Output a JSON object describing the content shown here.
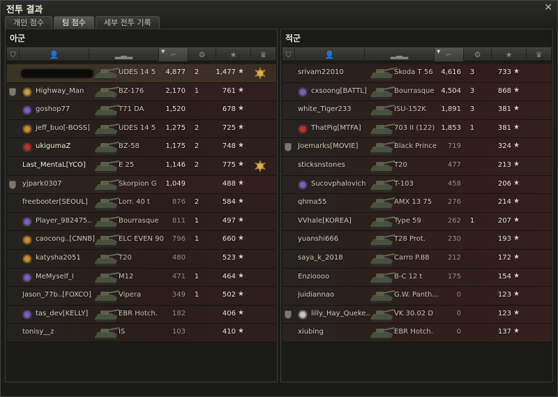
{
  "window": {
    "title": "전투 결과",
    "close_icon": "close-icon"
  },
  "tabs": [
    {
      "label": "개인 점수",
      "active": false
    },
    {
      "label": "팀 점수",
      "active": true
    },
    {
      "label": "세부 전투 기록",
      "active": false
    }
  ],
  "header_icons": [
    "squad-icon",
    "player-icon",
    "tank-icon",
    "damage-icon",
    "kills-icon",
    "xp-star-icon",
    "medal-icon"
  ],
  "colors": {
    "player_row": "#3a3428",
    "ally_row": "#2a1d1b",
    "enemy_row": "#2e1e1c",
    "accent": "#d8d6c8"
  },
  "ally": {
    "title": "아군",
    "rows": [
      {
        "name": "",
        "censored": true,
        "tank": "UDES 14 5",
        "damage": "4,877",
        "kills": "2",
        "xp": "1,477",
        "medal": true,
        "player": true,
        "emblem": "",
        "platoon": false
      },
      {
        "name": "Highway_Man",
        "tank": "BZ-176",
        "damage": "2,170",
        "kills": "1",
        "xp": "761",
        "medal": false,
        "emblem": "#c8a040",
        "platoon": true
      },
      {
        "name": "goshop77",
        "tank": "T71 DA",
        "damage": "1,520",
        "kills": "",
        "xp": "678",
        "medal": false,
        "emblem": "#7a60c0",
        "platoon": false
      },
      {
        "name": "jeff_buo[-BOSS]",
        "tank": "UDES 14 5",
        "damage": "1,275",
        "kills": "2",
        "xp": "725",
        "medal": false,
        "emblem": "#d09030",
        "platoon": false
      },
      {
        "name": "ukigumaZ",
        "tank": "BZ-58",
        "damage": "1,175",
        "kills": "2",
        "xp": "748",
        "medal": false,
        "emblem": "#c03030",
        "platoon": false,
        "bright": true
      },
      {
        "name": "Last_MentaL[YCO]",
        "tank": "E 25",
        "damage": "1,146",
        "kills": "2",
        "xp": "775",
        "medal": true,
        "emblem": "",
        "platoon": false,
        "bright": true
      },
      {
        "name": "yjpark0307",
        "tank": "Skorpion G",
        "damage": "1,049",
        "kills": "",
        "xp": "488",
        "medal": false,
        "emblem": "",
        "platoon": true
      },
      {
        "name": "freebooter[SEOUL]",
        "tank": "Lorr. 40 t",
        "damage": "876",
        "kills": "2",
        "xp": "584",
        "medal": false,
        "emblem": "",
        "platoon": false
      },
      {
        "name": "Player_982475..",
        "tank": "Bourrasque",
        "damage": "811",
        "kills": "1",
        "xp": "497",
        "medal": false,
        "emblem": "#7a60c0",
        "platoon": false
      },
      {
        "name": "caocong..[CNNB]",
        "tank": "ELC EVEN 90",
        "damage": "796",
        "kills": "1",
        "xp": "660",
        "medal": false,
        "emblem": "#d09030",
        "platoon": false
      },
      {
        "name": "katysha2051",
        "tank": "T20",
        "damage": "480",
        "kills": "",
        "xp": "523",
        "medal": false,
        "emblem": "#d09030",
        "platoon": false
      },
      {
        "name": "MeMyself_I",
        "tank": "M12",
        "damage": "471",
        "kills": "1",
        "xp": "464",
        "medal": false,
        "emblem": "#7a60c0",
        "platoon": false
      },
      {
        "name": "Jason_77b..[FOXCO]",
        "tank": "Vipera",
        "damage": "349",
        "kills": "1",
        "xp": "502",
        "medal": false,
        "emblem": "",
        "platoon": false
      },
      {
        "name": "tas_dev[KELLY]",
        "tank": "EBR Hotch.",
        "damage": "182",
        "kills": "",
        "xp": "406",
        "medal": false,
        "emblem": "#7a60c0",
        "platoon": false
      },
      {
        "name": "tonisy__z",
        "tank": "IS",
        "damage": "103",
        "kills": "",
        "xp": "410",
        "medal": false,
        "emblem": "",
        "platoon": false
      }
    ]
  },
  "enemy": {
    "title": "적군",
    "rows": [
      {
        "name": "srivam22010",
        "tank": "Škoda T 56",
        "damage": "4,616",
        "kills": "3",
        "xp": "733",
        "emblem": "",
        "platoon": false
      },
      {
        "name": "cxsoong[BATTL]",
        "tank": "Bourrasque",
        "damage": "4,504",
        "kills": "3",
        "xp": "868",
        "emblem": "#7a60c0",
        "platoon": false
      },
      {
        "name": "white_Tiger233",
        "tank": "ISU-152K",
        "damage": "1,891",
        "kills": "3",
        "xp": "381",
        "emblem": "",
        "platoon": false
      },
      {
        "name": "ThatPig[MTFA]",
        "tank": "703 II (122)",
        "damage": "1,853",
        "kills": "1",
        "xp": "381",
        "emblem": "#c03030",
        "platoon": false
      },
      {
        "name": "Joemarks[MOVIE]",
        "tank": "Black Prince",
        "damage": "719",
        "kills": "",
        "xp": "324",
        "emblem": "",
        "platoon": true
      },
      {
        "name": "sticksnstones",
        "tank": "T20",
        "damage": "477",
        "kills": "",
        "xp": "213",
        "emblem": "",
        "platoon": false
      },
      {
        "name": "Sucovphalovich",
        "tank": "T-103",
        "damage": "458",
        "kills": "",
        "xp": "206",
        "emblem": "#7a60c0",
        "platoon": false
      },
      {
        "name": "qhma55",
        "tank": "AMX 13 75",
        "damage": "276",
        "kills": "",
        "xp": "214",
        "emblem": "",
        "platoon": false
      },
      {
        "name": "VVhale[KOREA]",
        "tank": "Type 59",
        "damage": "262",
        "kills": "1",
        "xp": "207",
        "emblem": "",
        "platoon": false
      },
      {
        "name": "yuanshi666",
        "tank": "T28 Prot.",
        "damage": "230",
        "kills": "",
        "xp": "193",
        "emblem": "",
        "platoon": false
      },
      {
        "name": "saya_k_2018",
        "tank": "Carro P.88",
        "damage": "212",
        "kills": "",
        "xp": "172",
        "emblem": "",
        "platoon": false
      },
      {
        "name": "Enzioooo",
        "tank": "B-C 12 t",
        "damage": "175",
        "kills": "",
        "xp": "154",
        "emblem": "",
        "platoon": false
      },
      {
        "name": "juidiannao",
        "tank": "G.W. Panth...",
        "damage": "0",
        "kills": "",
        "xp": "123",
        "emblem": "",
        "platoon": false
      },
      {
        "name": "lilly_Hay_Queke..",
        "tank": "VK 30.02 D",
        "damage": "0",
        "kills": "",
        "xp": "123",
        "emblem": "#c8c8d0",
        "platoon": true
      },
      {
        "name": "xiubing",
        "tank": "EBR Hotch.",
        "damage": "0",
        "kills": "",
        "xp": "137",
        "emblem": "",
        "platoon": false
      }
    ]
  }
}
